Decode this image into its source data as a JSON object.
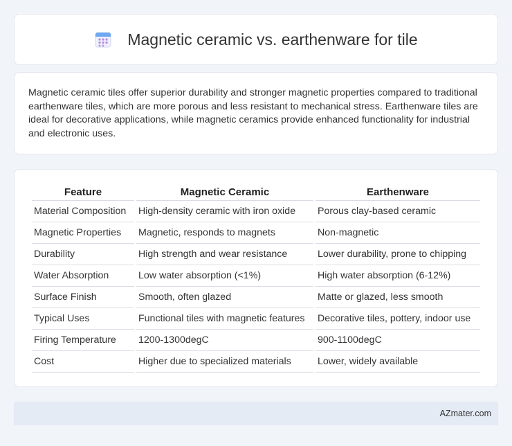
{
  "header": {
    "title": "Magnetic ceramic vs. earthenware for tile",
    "icon": "calendar-grid-icon"
  },
  "summary": {
    "text": "Magnetic ceramic tiles offer superior durability and stronger magnetic properties compared to traditional earthenware tiles, which are more porous and less resistant to mechanical stress. Earthenware tiles are ideal for decorative applications, while magnetic ceramics provide enhanced functionality for industrial and electronic uses."
  },
  "table": {
    "headers": [
      "Feature",
      "Magnetic Ceramic",
      "Earthenware"
    ],
    "rows": [
      [
        "Material Composition",
        "High-density ceramic with iron oxide",
        "Porous clay-based ceramic"
      ],
      [
        "Magnetic Properties",
        "Magnetic, responds to magnets",
        "Non-magnetic"
      ],
      [
        "Durability",
        "High strength and wear resistance",
        "Lower durability, prone to chipping"
      ],
      [
        "Water Absorption",
        "Low water absorption (<1%)",
        "High water absorption (6-12%)"
      ],
      [
        "Surface Finish",
        "Smooth, often glazed",
        "Matte or glazed, less smooth"
      ],
      [
        "Typical Uses",
        "Functional tiles with magnetic features",
        "Decorative tiles, pottery, indoor use"
      ],
      [
        "Firing Temperature",
        "1200-1300degC",
        "900-1100degC"
      ],
      [
        "Cost",
        "Higher due to specialized materials",
        "Lower, widely available"
      ]
    ]
  },
  "footer": {
    "brand": "AZmater.com"
  },
  "colors": {
    "background": "#f1f4f9",
    "card": "#ffffff",
    "footer": "#e4ebf5",
    "icon_top": "#6fa8f0",
    "icon_body": "#eef0fb",
    "icon_dots": "#b48be0"
  }
}
